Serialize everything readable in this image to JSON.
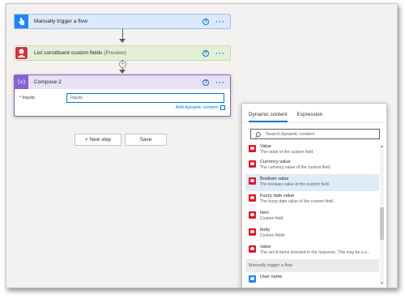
{
  "flow": {
    "trigger": {
      "title": "Manually trigger a flow"
    },
    "list_fields": {
      "title": "List constituent custom fields",
      "suffix": "(Preview)"
    },
    "compose": {
      "title": "Compose 2",
      "inputs_label": "* Inputs",
      "inputs_value": "Inputs",
      "add_dynamic_label": "Add dynamic content"
    },
    "help_glyph": "?",
    "more_glyph": "···",
    "plus_glyph": "+"
  },
  "buttons": {
    "new_step": "+ New step",
    "save": "Save"
  },
  "dynamic_panel": {
    "tabs": [
      {
        "label": "Dynamic content"
      },
      {
        "label": "Expression"
      }
    ],
    "search_placeholder": "Search dynamic content",
    "items": [
      {
        "name": "Value",
        "desc": "The value of the custom field."
      },
      {
        "name": "Currency value",
        "desc": "The currency value of the custom field."
      },
      {
        "name": "Boolean value",
        "desc": "The boolean value of the custom field."
      },
      {
        "name": "Fuzzy date value",
        "desc": "The fuzzy date value of the custom field."
      },
      {
        "name": "Item",
        "desc": "Custom field"
      },
      {
        "name": "body",
        "desc": "Custom fields"
      },
      {
        "name": "value",
        "desc": "The set of items included in the response. This may be a s..."
      }
    ],
    "group_header": "Manually trigger a flow",
    "trigger_items": [
      {
        "name": "User name"
      }
    ],
    "scroll_up": "▲",
    "scroll_down": "▼"
  },
  "colors": {
    "trigger_accent": "#1f85ff",
    "list_accent": "#e3efd7",
    "compose_accent": "#8a63d2",
    "link_blue": "#0078d4",
    "icon_red": "#e81123"
  },
  "icons": {
    "trigger": "hand-pointer-icon",
    "list": "person-card-icon",
    "compose": "braces-icon",
    "search": "search-icon",
    "item": "custom-field-icon"
  }
}
